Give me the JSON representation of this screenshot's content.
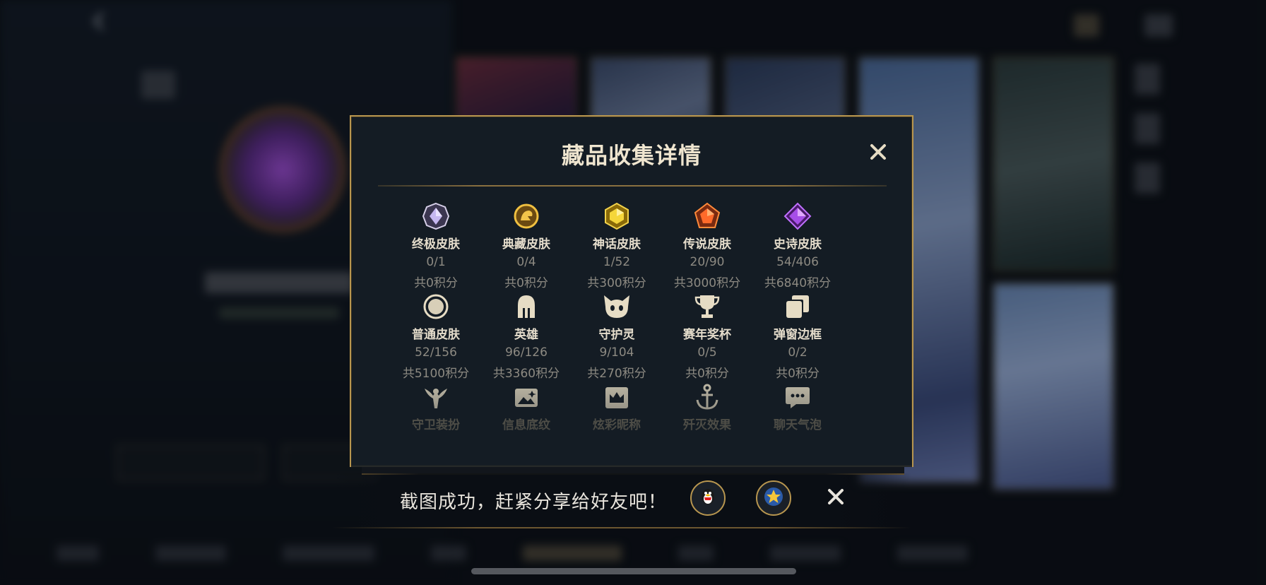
{
  "modal": {
    "title": "藏品收集详情",
    "rows": [
      [
        {
          "icon": "ultimate-gem-icon",
          "name": "终极皮肤",
          "count": "0/1",
          "points": "共0积分"
        },
        {
          "icon": "prestige-dragon-icon",
          "name": "典藏皮肤",
          "count": "0/4",
          "points": "共0积分"
        },
        {
          "icon": "mythic-gem-icon",
          "name": "神话皮肤",
          "count": "1/52",
          "points": "共300积分"
        },
        {
          "icon": "legendary-gem-icon",
          "name": "传说皮肤",
          "count": "20/90",
          "points": "共3000积分"
        },
        {
          "icon": "epic-gem-icon",
          "name": "史诗皮肤",
          "count": "54/406",
          "points": "共6840积分"
        }
      ],
      [
        {
          "icon": "standard-circle-icon",
          "name": "普通皮肤",
          "count": "52/156",
          "points": "共5100积分"
        },
        {
          "icon": "helmet-icon",
          "name": "英雄",
          "count": "96/126",
          "points": "共3360积分"
        },
        {
          "icon": "little-legend-icon",
          "name": "守护灵",
          "count": "9/104",
          "points": "共270积分"
        },
        {
          "icon": "trophy-icon",
          "name": "赛年奖杯",
          "count": "0/5",
          "points": "共0积分"
        },
        {
          "icon": "pages-icon",
          "name": "弹窗边框",
          "count": "0/2",
          "points": "共0积分"
        }
      ],
      [
        {
          "icon": "ward-icon",
          "name": "守卫装扮"
        },
        {
          "icon": "banner-image-icon",
          "name": "信息底纹"
        },
        {
          "icon": "crown-card-icon",
          "name": "炫彩昵称"
        },
        {
          "icon": "anchor-icon",
          "name": "歼灭效果"
        },
        {
          "icon": "chat-bubble-icon",
          "name": "聊天气泡"
        }
      ]
    ]
  },
  "toast": {
    "text": "截图成功，赶紧分享给好友吧！",
    "share_icons": [
      "qq-penguin-icon",
      "star-favorite-icon"
    ]
  },
  "colors": {
    "gold": "#b8964f",
    "panel": "#141c24",
    "title": "#efe5cf",
    "muted": "#8d8a82"
  }
}
